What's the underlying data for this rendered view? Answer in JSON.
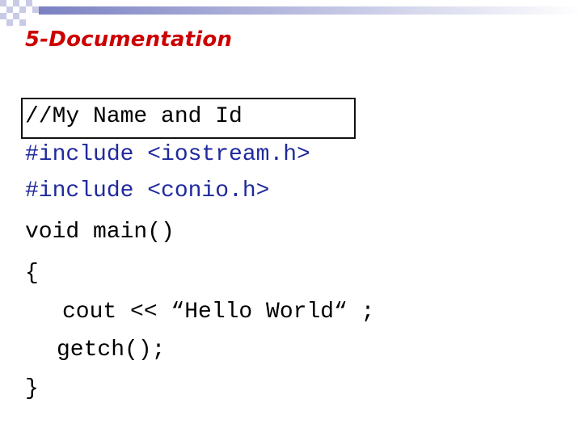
{
  "slide": {
    "title": "5-Documentation",
    "code": {
      "comment": "//My Name and Id",
      "include_kw_1": "#include",
      "include_arg_1": " <iostream.h>",
      "include_kw_2": "#include",
      "include_arg_2": " <conio.h>",
      "main_line": "void main()",
      "open_brace": "{",
      "cout_line": "cout << “Hello World“ ;",
      "getch_line": "getch();",
      "close_brace": "}"
    }
  },
  "colors": {
    "title": "#cc0000",
    "keyword_blue": "#1f2a9c",
    "text": "#000000"
  }
}
